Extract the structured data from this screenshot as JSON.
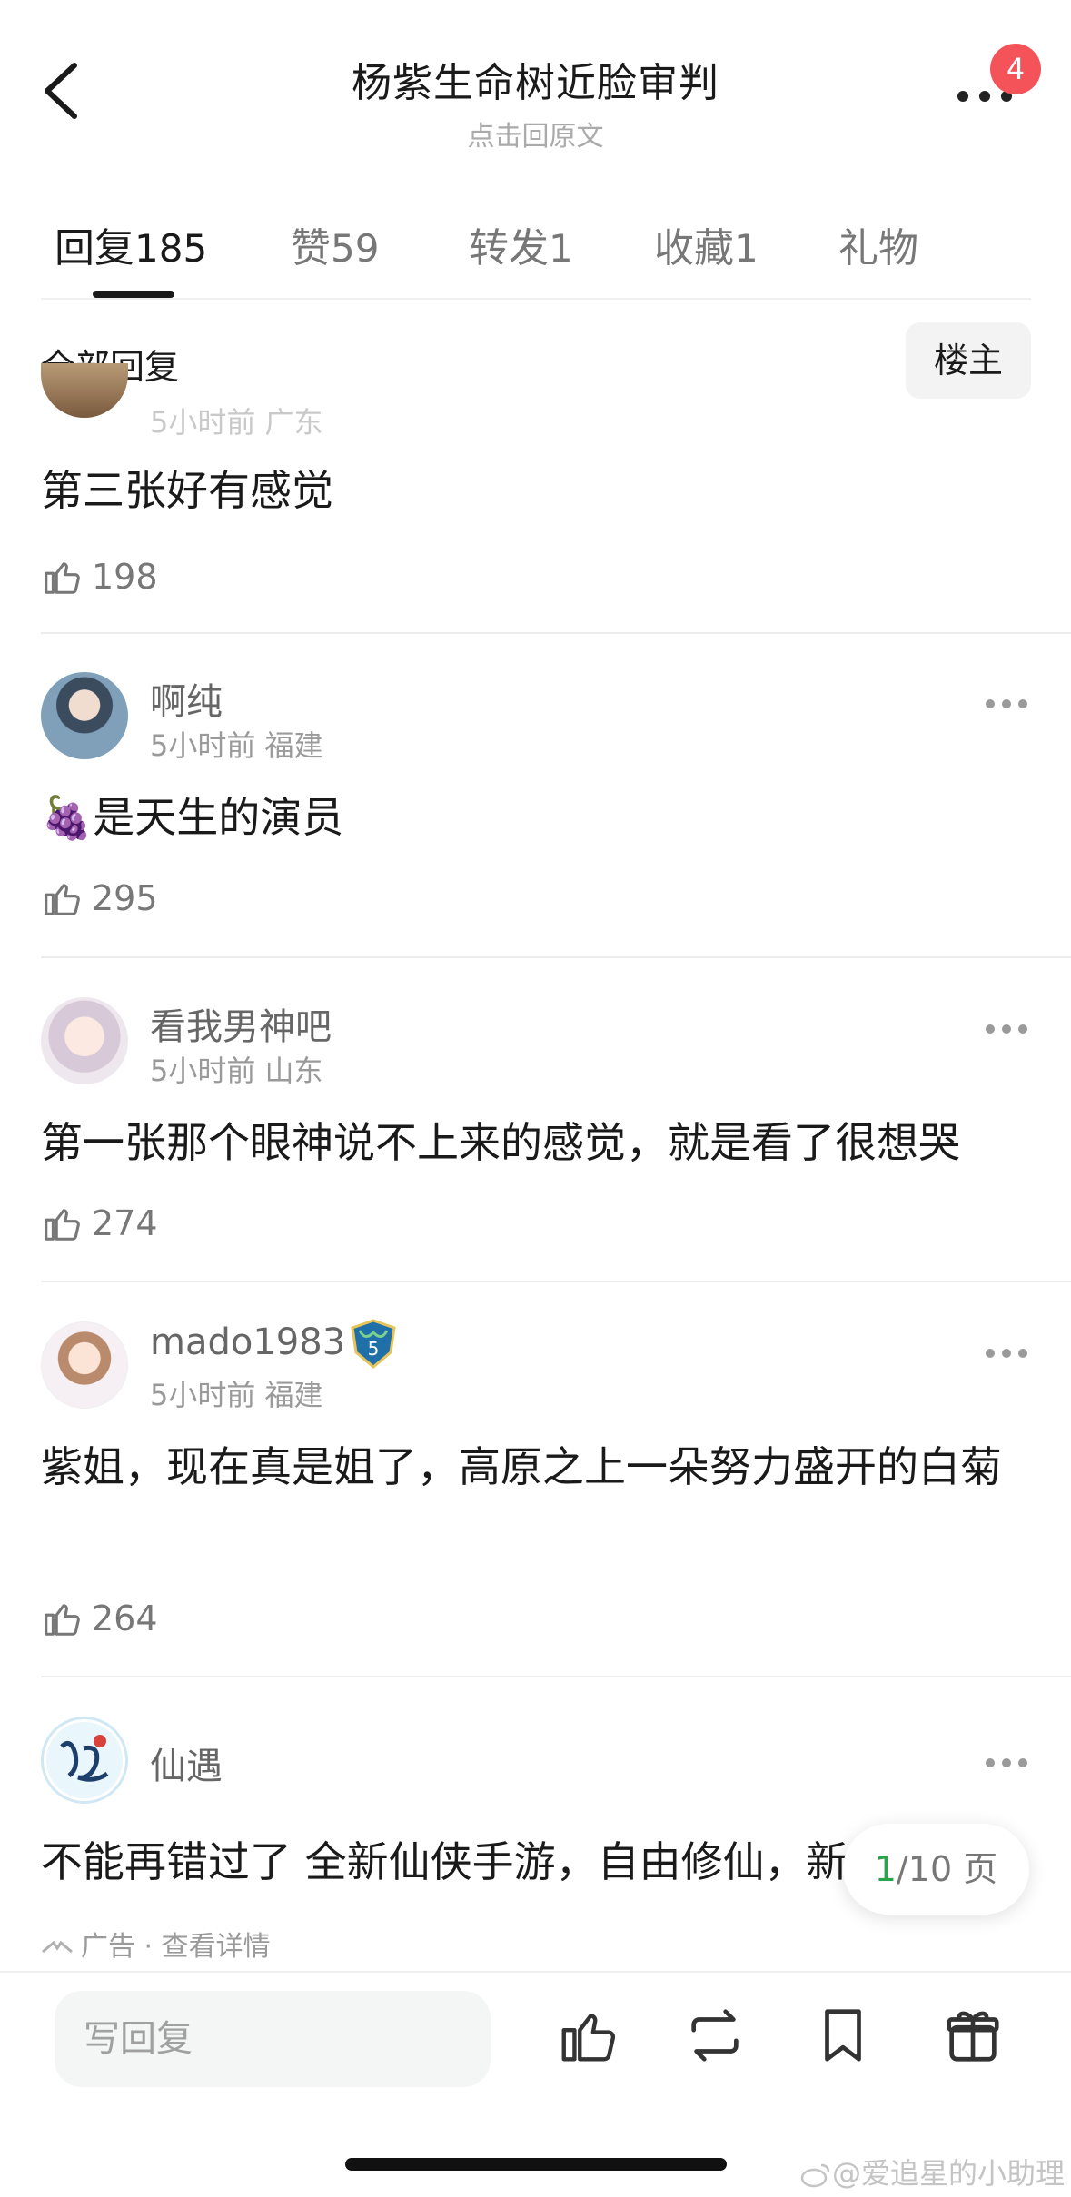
{
  "header": {
    "title": "杨紫生命树近脸审判",
    "subtitle": "点击回原文",
    "notification_count": "4"
  },
  "tabs": [
    {
      "label": "回复",
      "count": "185",
      "active": true
    },
    {
      "label": "赞",
      "count": "59"
    },
    {
      "label": "转发",
      "count": "1"
    },
    {
      "label": "收藏",
      "count": "1"
    },
    {
      "label": "礼物",
      "count": ""
    }
  ],
  "filter": {
    "label": "全部回复",
    "owner_button": "楼主"
  },
  "comments": [
    {
      "partial": true,
      "meta": "5小时前 广东",
      "text": "第三张好有感觉",
      "likes": "198"
    },
    {
      "username": "啊纯",
      "meta": "5小时前 福建",
      "text": "🍇是天生的演员",
      "likes": "295"
    },
    {
      "username": "看我男神吧",
      "meta": "5小时前 山东",
      "text": "第一张那个眼神说不上来的感觉，就是看了很想哭",
      "likes": "274"
    },
    {
      "username": "mado1983",
      "level": "5",
      "meta": "5小时前 福建",
      "text": "紫姐，现在真是姐了，高原之上一朵努力盛开的白菊",
      "likes": "264"
    }
  ],
  "ad": {
    "username": "仙遇",
    "text": "不能再错过了 全新仙侠手游，自由修仙，新",
    "label": "广告 · 查看详情"
  },
  "pagination": {
    "current": "1",
    "total": "/10 页"
  },
  "bottom_bar": {
    "reply_placeholder": "写回复"
  },
  "watermark": "@爱追星的小助理",
  "colors": {
    "badge": "#f4535a",
    "page_current": "#2aa44a",
    "text_primary": "#1a1a1a",
    "text_secondary": "#9a9a9a"
  }
}
